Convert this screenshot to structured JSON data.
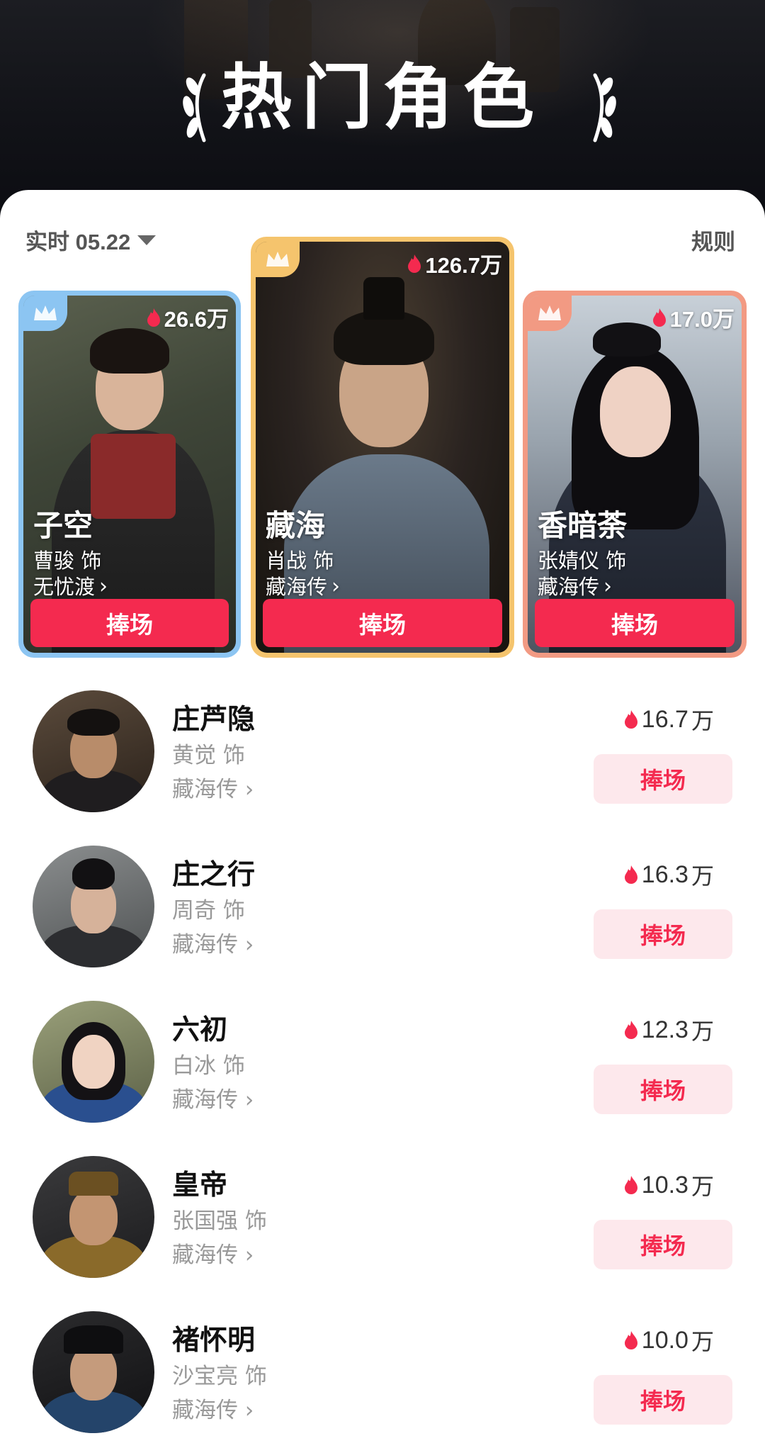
{
  "header": {
    "title": "热门角色"
  },
  "toolbar": {
    "time_filter": "实时 05.22",
    "rules_label": "规则"
  },
  "top3": [
    {
      "rank": 2,
      "heat": "26.6万",
      "name": "子空",
      "actor": "曹骏 饰",
      "show": "无忧渡",
      "cheer": "捧场"
    },
    {
      "rank": 1,
      "heat": "126.7万",
      "name": "藏海",
      "actor": "肖战 饰",
      "show": "藏海传",
      "cheer": "捧场"
    },
    {
      "rank": 3,
      "heat": "17.0万",
      "name": "香暗荼",
      "actor": "张婧仪 饰",
      "show": "藏海传",
      "cheer": "捧场"
    }
  ],
  "list": [
    {
      "name": "庄芦隐",
      "actor": "黄觉 饰",
      "show": "藏海传",
      "heat": "16.7",
      "unit": "万",
      "cheer": "捧场"
    },
    {
      "name": "庄之行",
      "actor": "周奇 饰",
      "show": "藏海传",
      "heat": "16.3",
      "unit": "万",
      "cheer": "捧场"
    },
    {
      "name": "六初",
      "actor": "白冰 饰",
      "show": "藏海传",
      "heat": "12.3",
      "unit": "万",
      "cheer": "捧场"
    },
    {
      "name": "皇帝",
      "actor": "张国强 饰",
      "show": "藏海传",
      "heat": "10.3",
      "unit": "万",
      "cheer": "捧场"
    },
    {
      "name": "褚怀明",
      "actor": "沙宝亮 饰",
      "show": "藏海传",
      "heat": "10.0",
      "unit": "万",
      "cheer": "捧场"
    }
  ],
  "colors": {
    "accent": "#f42a4f",
    "cheer_soft_bg": "#fde8ec",
    "rank1_frame": "#f5c46d",
    "rank2_frame": "#8cc5f2",
    "rank3_frame": "#f29a83"
  },
  "icons": {
    "crown": "crown-icon",
    "flame": "flame-icon",
    "chevron": "chevron-right-icon",
    "dropdown": "caret-down-icon",
    "laurel": "laurel-icon"
  }
}
